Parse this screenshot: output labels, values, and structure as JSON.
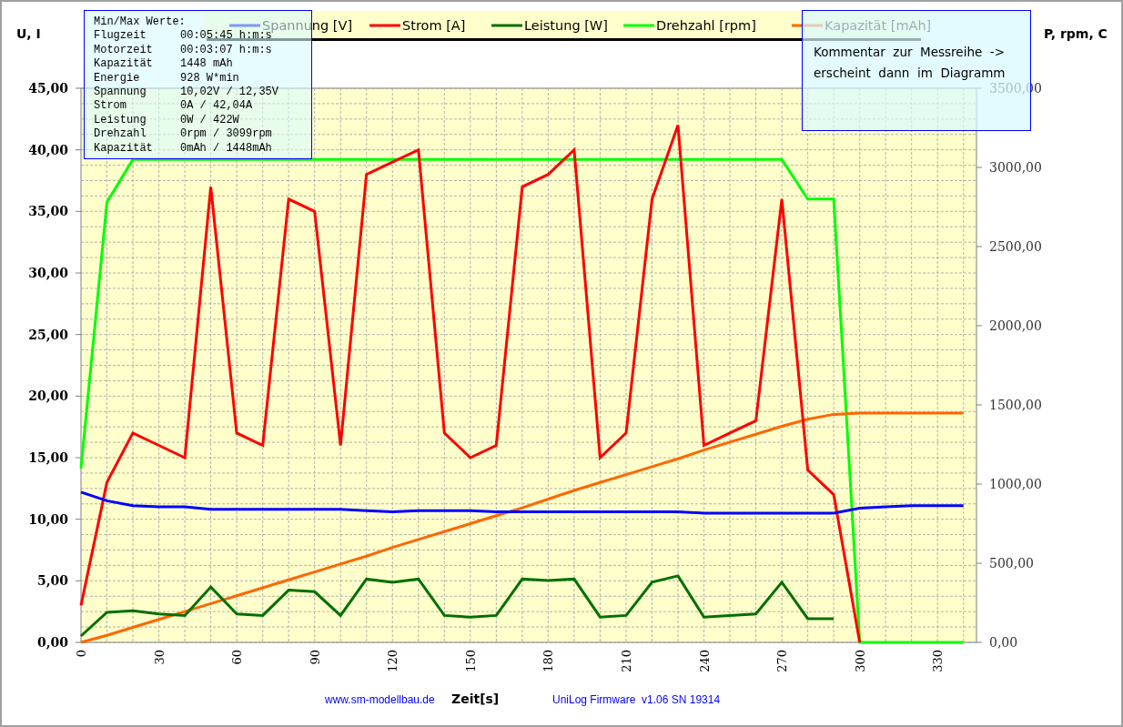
{
  "chart": {
    "chart_data": {
      "type": "line",
      "grid": true,
      "legend": true,
      "xlabel": "Zeit[s]",
      "ylabel": "U, I",
      "y2label": "P, rpm, C",
      "xlim": [
        0,
        345
      ],
      "ylim": [
        0,
        45
      ],
      "y2lim": [
        0,
        3500
      ],
      "x": [
        0,
        10,
        20,
        30,
        40,
        50,
        60,
        70,
        80,
        90,
        100,
        110,
        120,
        130,
        140,
        150,
        160,
        170,
        180,
        190,
        200,
        210,
        220,
        230,
        240,
        250,
        260,
        270,
        280,
        290,
        300,
        310,
        320,
        330,
        340
      ],
      "series": [
        {
          "name": "Spannung [V]",
          "color": "#0000ff",
          "values": [
            12.2,
            11.5,
            11.1,
            11.0,
            11.0,
            10.8,
            10.8,
            10.8,
            10.8,
            10.8,
            10.8,
            10.7,
            10.6,
            10.7,
            10.7,
            10.7,
            10.6,
            10.6,
            10.6,
            10.6,
            10.6,
            10.6,
            10.6,
            10.6,
            10.5,
            10.5,
            10.5,
            10.5,
            10.5,
            10.5,
            10.9,
            11.0,
            11.1,
            11.1,
            11.1
          ]
        },
        {
          "name": "Strom [A]",
          "color": "#ff0000",
          "values": [
            3,
            13,
            17,
            16,
            15,
            37,
            17,
            16,
            36,
            35,
            16,
            38,
            39,
            40,
            17,
            15,
            16,
            37,
            38,
            40,
            15,
            17,
            36,
            42,
            16,
            17,
            18,
            36,
            14,
            12,
            0,
            null,
            null,
            null,
            null
          ]
        },
        {
          "name": "Leistung [W]",
          "color": "#007000",
          "axis": "y2",
          "values": [
            40,
            190,
            200,
            180,
            170,
            350,
            180,
            170,
            330,
            320,
            170,
            400,
            380,
            400,
            170,
            160,
            170,
            400,
            390,
            400,
            160,
            170,
            380,
            420,
            160,
            170,
            180,
            380,
            150,
            150,
            null,
            null,
            null,
            null,
            null
          ]
        },
        {
          "name": "Drehzahl [rpm]",
          "color": "#00ff00",
          "axis": "y2",
          "values": [
            1100,
            2780,
            3050,
            3050,
            3050,
            3050,
            3050,
            3050,
            3050,
            3050,
            3050,
            3050,
            3050,
            3050,
            3050,
            3050,
            3050,
            3050,
            3050,
            3050,
            3050,
            3050,
            3050,
            3050,
            3050,
            3050,
            3050,
            3050,
            2800,
            2800,
            0,
            0,
            0,
            0,
            0
          ]
        },
        {
          "name": "Kapazität [mAh]",
          "color": "#ff6600",
          "axis": "y2",
          "values": [
            0,
            45,
            95,
            145,
            195,
            245,
            295,
            345,
            395,
            445,
            495,
            545,
            600,
            650,
            700,
            750,
            800,
            850,
            905,
            960,
            1010,
            1060,
            1110,
            1160,
            1215,
            1265,
            1315,
            1365,
            1410,
            1440,
            1448,
            1448,
            1448,
            1448,
            1448
          ]
        }
      ],
      "xticks": [
        0,
        30,
        60,
        90,
        120,
        150,
        180,
        210,
        240,
        270,
        300,
        330
      ],
      "yticks": [
        {
          "value": 0,
          "label": "0,00"
        },
        {
          "value": 5,
          "label": "5,00"
        },
        {
          "value": 10,
          "label": "10,00"
        },
        {
          "value": 15,
          "label": "15,00"
        },
        {
          "value": 20,
          "label": "20,00"
        },
        {
          "value": 25,
          "label": "25,00"
        },
        {
          "value": 30,
          "label": "30,00"
        },
        {
          "value": 35,
          "label": "35,00"
        },
        {
          "value": 40,
          "label": "40,00"
        },
        {
          "value": 45,
          "label": "45,00"
        }
      ],
      "y2ticks": [
        {
          "value": 0,
          "label": "0,00"
        },
        {
          "value": 500,
          "label": "500,00"
        },
        {
          "value": 1000,
          "label": "1000,00"
        },
        {
          "value": 1500,
          "label": "1500,00"
        },
        {
          "value": 2000,
          "label": "2000,00"
        },
        {
          "value": 2500,
          "label": "2500,00"
        },
        {
          "value": 3000,
          "label": "3000,00"
        },
        {
          "value": 3500,
          "label": "3500,00"
        }
      ]
    }
  },
  "min_max": {
    "title": "Min/Max Werte:",
    "rows": [
      {
        "label": "Flugzeit",
        "value": "00:05:45 h:m:s"
      },
      {
        "label": "Motorzeit",
        "value": "00:03:07 h:m:s"
      },
      {
        "label": "Kapazität",
        "value": "1448 mAh"
      },
      {
        "label": "Energie",
        "value": "928 W*min"
      },
      {
        "label": "Spannung",
        "value": "10,02V / 12,35V"
      },
      {
        "label": "Strom",
        "value": "0A / 42,04A"
      },
      {
        "label": "Leistung",
        "value": "0W / 422W"
      },
      {
        "label": "Drehzahl",
        "value": "0rpm / 3099rpm"
      },
      {
        "label": "Kapazität",
        "value": "0mAh / 1448mAh"
      }
    ]
  },
  "comment": {
    "lines": [
      "Kommentar  zur  Messreihe  ->",
      "erscheint  dann  im  Diagramm"
    ]
  },
  "footer": {
    "website": "www.sm-modellbau.de",
    "firmware": "UniLog Firmware  v1.06 SN 19314"
  }
}
